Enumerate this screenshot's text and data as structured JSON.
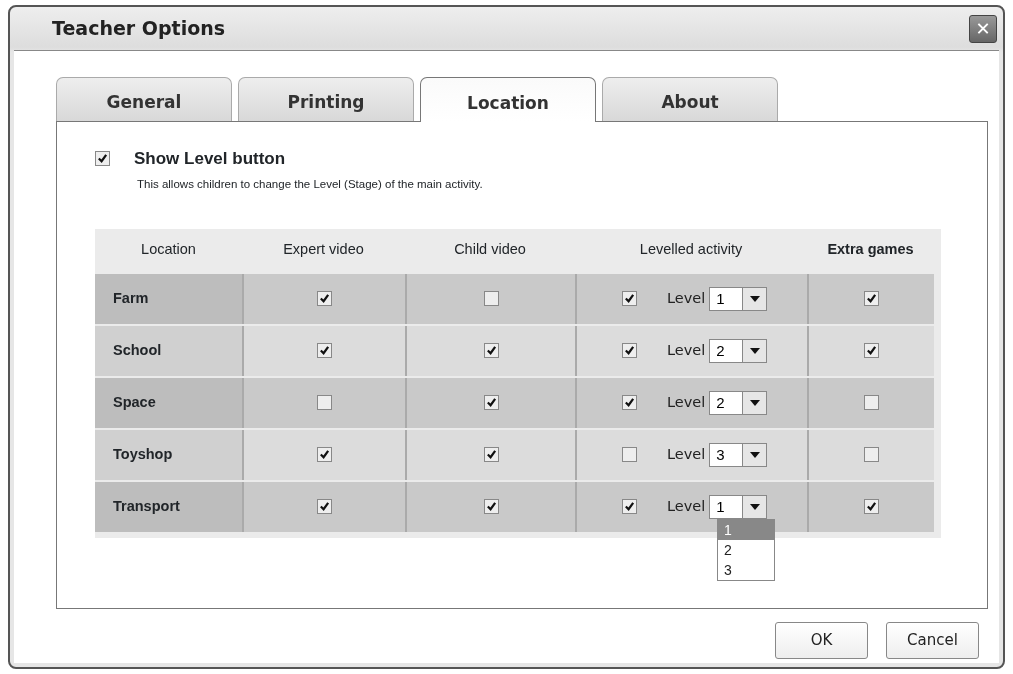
{
  "window": {
    "title": "Teacher Options",
    "close": "✕"
  },
  "tabs": [
    {
      "label": "General",
      "selected": false
    },
    {
      "label": "Printing",
      "selected": false
    },
    {
      "label": "Location",
      "selected": true
    },
    {
      "label": "About",
      "selected": false
    }
  ],
  "show_level": {
    "label": "Show Level button",
    "checked": true,
    "description": "This allows children to change the Level (Stage) of the main activity."
  },
  "table": {
    "columns": [
      "Location",
      "Expert video",
      "Child video",
      "Levelled activity",
      "Extra games"
    ],
    "rows": [
      {
        "location": "Farm",
        "expert_video": true,
        "child_video": false,
        "levelled_activity": true,
        "level_label": "Level",
        "level": "1",
        "extra_games": true
      },
      {
        "location": "School",
        "expert_video": true,
        "child_video": true,
        "levelled_activity": true,
        "level_label": "Level",
        "level": "2",
        "extra_games": true
      },
      {
        "location": "Space",
        "expert_video": false,
        "child_video": true,
        "levelled_activity": true,
        "level_label": "Level",
        "level": "2",
        "extra_games": false
      },
      {
        "location": "Toyshop",
        "expert_video": true,
        "child_video": true,
        "levelled_activity": false,
        "level_label": "Level",
        "level": "3",
        "extra_games": false
      },
      {
        "location": "Transport",
        "expert_video": true,
        "child_video": true,
        "levelled_activity": true,
        "level_label": "Level",
        "level": "1",
        "extra_games": true,
        "open_options": [
          {
            "label": "1",
            "selected": true
          },
          {
            "label": "2",
            "selected": false
          },
          {
            "label": "3",
            "selected": false
          }
        ]
      }
    ]
  },
  "buttons": [
    "OK",
    "Cancel"
  ]
}
